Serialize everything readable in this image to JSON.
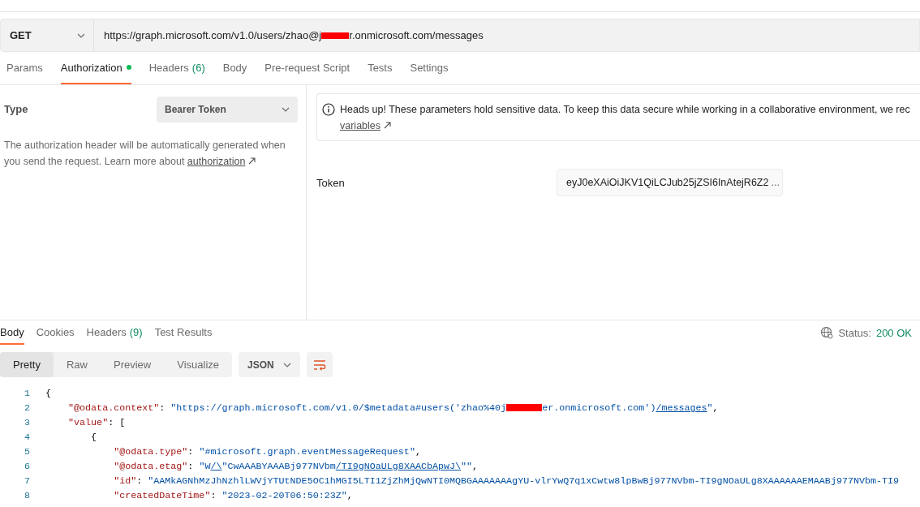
{
  "request": {
    "method": "GET",
    "url_before": "https://graph.microsoft.com/v1.0/users/zhao@j",
    "url_redacted": true,
    "url_after": "r.onmicrosoft.com/messages"
  },
  "request_tabs": [
    {
      "label": "Params",
      "selected": false,
      "dot": false
    },
    {
      "label": "Authorization",
      "selected": true,
      "dot": true
    },
    {
      "label": "Headers",
      "count": "(6)",
      "selected": false,
      "dot": false
    },
    {
      "label": "Body",
      "selected": false,
      "dot": false
    },
    {
      "label": "Pre-request Script",
      "selected": false,
      "dot": false
    },
    {
      "label": "Tests",
      "selected": false,
      "dot": false
    },
    {
      "label": "Settings",
      "selected": false,
      "dot": false
    }
  ],
  "auth": {
    "type_label": "Type",
    "type_value": "Bearer Token",
    "description": "The authorization header will be automatically generated when you send the request. Learn more about",
    "description_link": "authorization",
    "notice": "Heads up! These parameters hold sensitive data. To keep this data secure while working in a collaborative environment, we rec",
    "notice_link": "variables",
    "token_label": "Token",
    "token_value": "eyJ0eXAiOiJKV1QiLCJub25jZSI6InAtejR6Z2",
    "token_more": "..."
  },
  "response_tabs": [
    {
      "label": "Body",
      "selected": true
    },
    {
      "label": "Cookies",
      "selected": false
    },
    {
      "label": "Headers",
      "count": "(9)",
      "selected": false
    },
    {
      "label": "Test Results",
      "selected": false
    }
  ],
  "status": {
    "label": "Status:",
    "value": "200 OK"
  },
  "view_modes": [
    {
      "label": "Pretty",
      "selected": true
    },
    {
      "label": "Raw",
      "selected": false
    },
    {
      "label": "Preview",
      "selected": false
    },
    {
      "label": "Visualize",
      "selected": false
    }
  ],
  "format": "JSON",
  "code_lines": [
    {
      "number": "1",
      "tokens": [
        {
          "kind": "punc",
          "text": "{"
        }
      ]
    },
    {
      "number": "2",
      "tokens": [
        {
          "kind": "key",
          "text": "    \"@odata.context\""
        },
        {
          "kind": "punc",
          "text": ": "
        },
        {
          "kind": "str",
          "text": "\"https://graph.microsoft.com/v1.0/$metadata#users('zhao%40j"
        },
        {
          "kind": "redaction"
        },
        {
          "kind": "str",
          "text": "er.onmicrosoft.com')"
        },
        {
          "kind": "link",
          "text": "/messages"
        },
        {
          "kind": "str",
          "text": "\""
        },
        {
          "kind": "punc",
          "text": ","
        }
      ]
    },
    {
      "number": "3",
      "tokens": [
        {
          "kind": "key",
          "text": "    \"value\""
        },
        {
          "kind": "punc",
          "text": ": ["
        }
      ]
    },
    {
      "number": "4",
      "tokens": [
        {
          "kind": "punc",
          "text": "        {"
        }
      ]
    },
    {
      "number": "5",
      "tokens": [
        {
          "kind": "key",
          "text": "            \"@odata.type\""
        },
        {
          "kind": "punc",
          "text": ": "
        },
        {
          "kind": "str",
          "text": "\"#microsoft.graph.eventMessageRequest\""
        },
        {
          "kind": "punc",
          "text": ","
        }
      ]
    },
    {
      "number": "6",
      "tokens": [
        {
          "kind": "key",
          "text": "            \"@odata.etag\""
        },
        {
          "kind": "punc",
          "text": ": "
        },
        {
          "kind": "str",
          "text": "\"W"
        },
        {
          "kind": "link",
          "text": "/\\"
        },
        {
          "kind": "str",
          "text": "\"CwAAABYAAABj977NVbm"
        },
        {
          "kind": "link",
          "text": "/TI9gNOaULg8XAACbApwJ\\"
        },
        {
          "kind": "str",
          "text": "\"\""
        },
        {
          "kind": "punc",
          "text": ","
        }
      ]
    },
    {
      "number": "7",
      "tokens": [
        {
          "kind": "key",
          "text": "            \"id\""
        },
        {
          "kind": "punc",
          "text": ": "
        },
        {
          "kind": "str",
          "text": "\"AAMkAGNhMzJhNzhlLWVjYTUtNDE5OC1hMGI5LTI1ZjZhMjQwNTI0MQBGAAAAAAAgYU-vlrYwQ7q1xCwtw8lpBwBj977NVbm-TI9gNOaULg8XAAAAAAEMAABj977NVbm-TI9"
        }
      ]
    },
    {
      "number": "8",
      "tokens": [
        {
          "kind": "key",
          "text": "            \"createdDateTime\""
        },
        {
          "kind": "punc",
          "text": ": "
        },
        {
          "kind": "str",
          "text": "\"2023-02-20T06:50:23Z\""
        },
        {
          "kind": "punc",
          "text": ","
        }
      ]
    }
  ]
}
